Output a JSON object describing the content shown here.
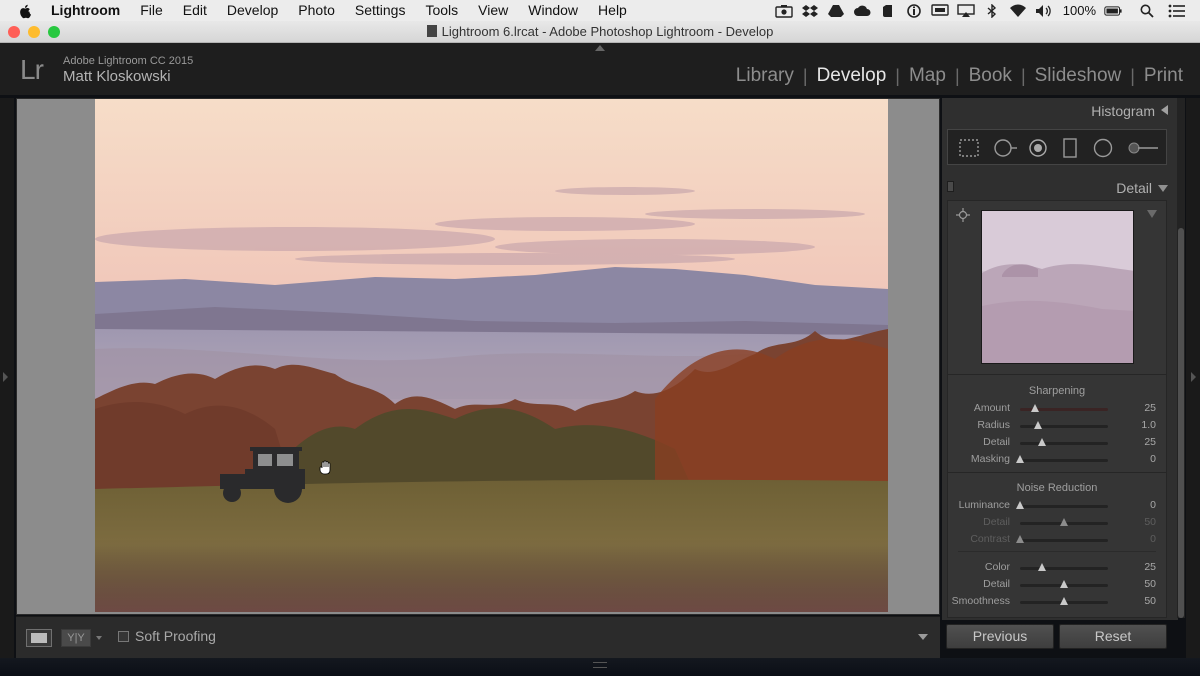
{
  "menubar": {
    "app_name": "Lightroom",
    "items": [
      "File",
      "Edit",
      "Develop",
      "Photo",
      "Settings",
      "Tools",
      "View",
      "Window",
      "Help"
    ],
    "battery": "100%",
    "status_icons": [
      "camera-icon",
      "dropbox-icon",
      "drive-icon",
      "creative-cloud-icon",
      "evernote-icon",
      "info-icon",
      "screen-icon",
      "airplay-icon",
      "bluetooth-icon",
      "wifi-icon",
      "volume-icon",
      "battery-icon",
      "spotlight-icon",
      "notification-center-icon"
    ]
  },
  "window": {
    "title": "Lightroom 6.lrcat - Adobe Photoshop Lightroom - Develop",
    "traffic_colors": [
      "#ff5f57",
      "#febc2e",
      "#28c840"
    ]
  },
  "identity": {
    "logo": "Lr",
    "product": "Adobe Lightroom CC 2015",
    "user": "Matt Kloskowski"
  },
  "modules": {
    "items": [
      "Library",
      "Develop",
      "Map",
      "Book",
      "Slideshow",
      "Print"
    ],
    "active": "Develop"
  },
  "toolbar": {
    "soft_proofing_label": "Soft Proofing",
    "soft_proofing_checked": false,
    "compare_label": "Y|Y"
  },
  "right_panel": {
    "histogram_title": "Histogram",
    "detail_title": "Detail",
    "sharpening": {
      "title": "Sharpening",
      "sliders": [
        {
          "label": "Amount",
          "value": "25",
          "pos": 0.17
        },
        {
          "label": "Radius",
          "value": "1.0",
          "pos": 0.2
        },
        {
          "label": "Detail",
          "value": "25",
          "pos": 0.25
        },
        {
          "label": "Masking",
          "value": "0",
          "pos": 0.0
        }
      ]
    },
    "noise_reduction": {
      "title": "Noise Reduction",
      "sliders": [
        {
          "label": "Luminance",
          "value": "0",
          "pos": 0.0,
          "dim": false
        },
        {
          "label": "Detail",
          "value": "50",
          "pos": 0.5,
          "dim": true
        },
        {
          "label": "Contrast",
          "value": "0",
          "pos": 0.0,
          "dim": true
        },
        {
          "label": "Color",
          "value": "25",
          "pos": 0.25,
          "dim": false
        },
        {
          "label": "Detail",
          "value": "50",
          "pos": 0.5,
          "dim": false
        },
        {
          "label": "Smoothness",
          "value": "50",
          "pos": 0.5,
          "dim": false
        }
      ]
    },
    "previous_label": "Previous",
    "reset_label": "Reset"
  }
}
